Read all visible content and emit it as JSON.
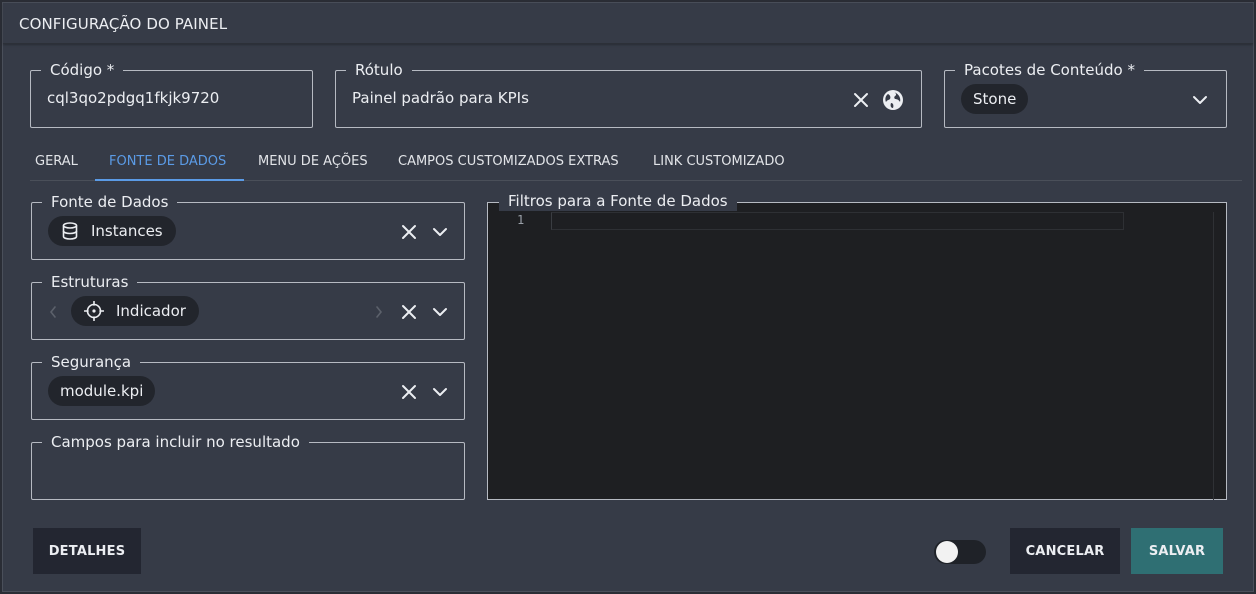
{
  "dialog": {
    "title": "CONFIGURAÇÃO DO PAINEL"
  },
  "codigo": {
    "label": "Código *",
    "value": "cql3qo2pdgq1fkjk9720"
  },
  "rotulo": {
    "label": "Rótulo",
    "value": "Painel padrão para KPIs"
  },
  "pacotes": {
    "label": "Pacotes de Conteúdo *",
    "chip": "Stone"
  },
  "tabs": [
    {
      "label": "GERAL"
    },
    {
      "label": "FONTE DE DADOS"
    },
    {
      "label": "MENU DE AÇÕES"
    },
    {
      "label": "CAMPOS CUSTOMIZADOS EXTRAS"
    },
    {
      "label": "LINK CUSTOMIZADO"
    }
  ],
  "active_tab": "FONTE DE DADOS",
  "fonte": {
    "label": "Fonte de Dados",
    "chip": "Instances",
    "icon": "database-icon"
  },
  "estruturas": {
    "label": "Estruturas",
    "chip": "Indicador",
    "icon": "crosshair-icon"
  },
  "seguranca": {
    "label": "Segurança",
    "chip": "module.kpi"
  },
  "campos": {
    "label": "Campos para incluir no resultado"
  },
  "filtros": {
    "label": "Filtros para a Fonte de Dados",
    "line_number": "1",
    "content": ""
  },
  "footer": {
    "details_label": "DETALHES",
    "cancel_label": "CANCELAR",
    "save_label": "SALVAR",
    "toggle_on": false
  },
  "colors": {
    "accent": "#5b9be6",
    "save": "#2f6f73",
    "background": "#363b47",
    "chip": "#22252c"
  }
}
